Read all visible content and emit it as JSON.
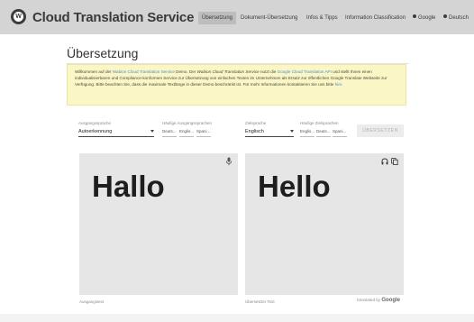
{
  "app": {
    "logo_letter": "W",
    "title": "Cloud Translation Service"
  },
  "nav": {
    "items": [
      {
        "label": "Übersetzung",
        "active": true
      },
      {
        "label": "Dokument-Übersetzung",
        "active": false
      },
      {
        "label": "Infos & Tipps",
        "active": false
      },
      {
        "label": "Information Classification",
        "active": false
      }
    ],
    "google_label": "Google",
    "deutsch_label": "Deutsch"
  },
  "page": {
    "title": "Übersetzung"
  },
  "notice": {
    "p1": "Willkommen auf der ",
    "link1": "Wabion Cloud Translation Service",
    "p2": " Demo. Der ",
    "em1": "Wabion Cloud Translation Service",
    "p3": " nutzt die ",
    "link2": "Google Cloud Translation API",
    "p4": " und stellt Ihnen einen individualisierbaren und Compliance-konformen Service zur Übersetzung von einfachen Texten im Unternehmen als Ersatz zur öffentlichen Google Translate Webseite zur Verfügung. Bitte beachten Sie, dass die maximale Textlänge in dieser Demo beschränkt ist. Für mehr Informationen kontaktieren Sie uns bitte ",
    "link3": "hier",
    "p5": "."
  },
  "source": {
    "label": "Ausgangssprache",
    "value": "Autoerkennung",
    "frequent_label": "Häufige Ausgangssprachen",
    "frequent": [
      "Deuts...",
      "Englis...",
      "Spani..."
    ]
  },
  "target": {
    "label": "Zielsprache",
    "value": "Englisch",
    "frequent_label": "Häufige Zielsprachen",
    "frequent": [
      "Englis...",
      "Deuts...",
      "Spani..."
    ]
  },
  "translate_button": "ÜBERSETZEN",
  "input": {
    "text": "Hallo",
    "caption": "Ausgangstext"
  },
  "output": {
    "text": "Hello",
    "caption": "Übersetzter Text",
    "credit_prefix": "translated by",
    "credit_brand": "Google"
  },
  "icons": {
    "logo": "wabion-logo-icon",
    "mic": "microphone-icon",
    "headphones": "headphones-icon",
    "copy": "copy-icon",
    "google": "google-icon",
    "globe": "globe-icon"
  }
}
